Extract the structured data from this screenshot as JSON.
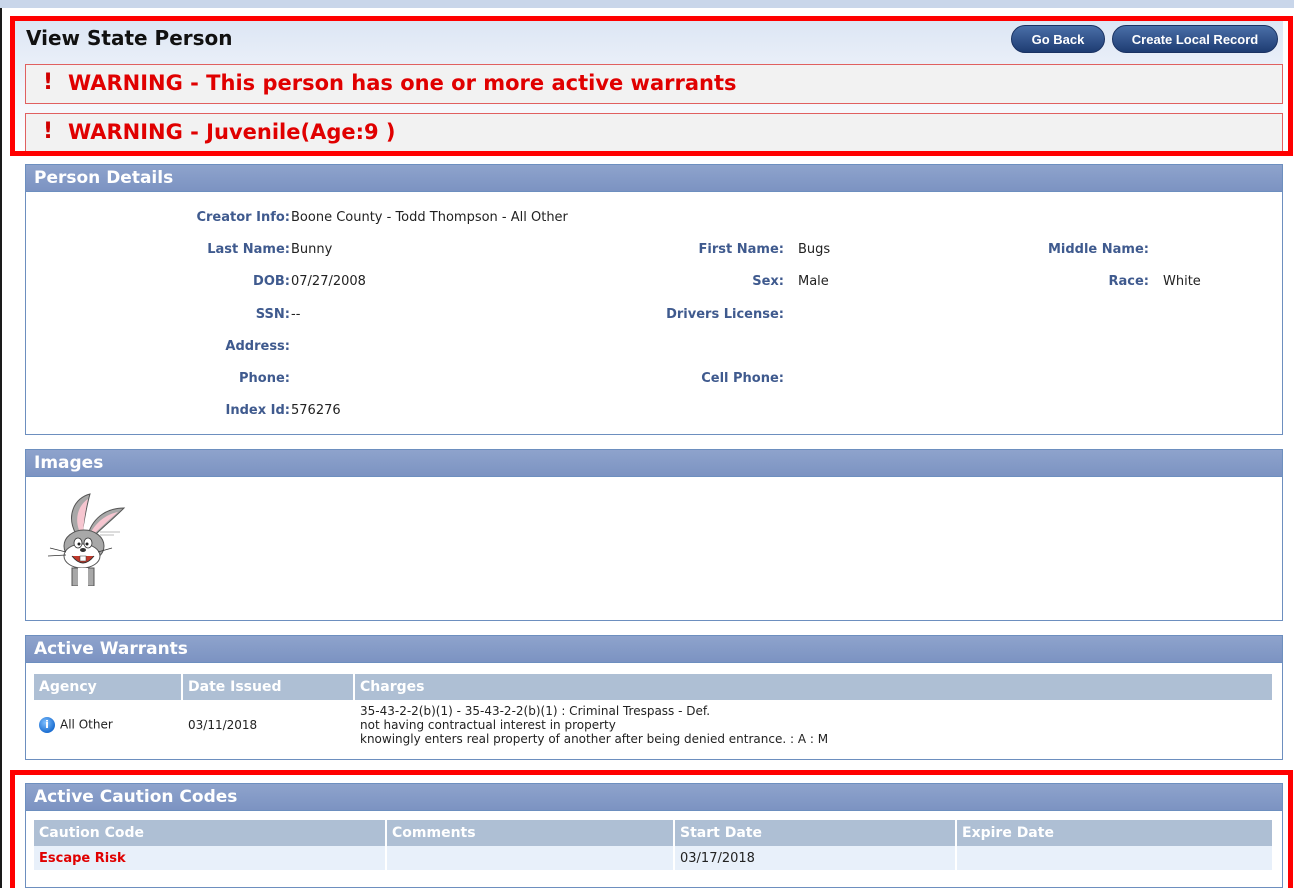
{
  "header": {
    "title": "View State Person",
    "buttons": {
      "go_back": "Go Back",
      "create_local": "Create Local Record"
    },
    "warnings": [
      "WARNING - This person has one or more active warrants",
      "WARNING - Juvenile(Age:9 )"
    ],
    "warning_icon": "!"
  },
  "person_details": {
    "heading": "Person Details",
    "creator_info": {
      "label": "Creator Info:",
      "value": "Boone County - Todd Thompson - All Other"
    },
    "last_name": {
      "label": "Last Name:",
      "value": "Bunny"
    },
    "first_name": {
      "label": "First Name:",
      "value": "Bugs"
    },
    "middle_name": {
      "label": "Middle Name:",
      "value": ""
    },
    "dob": {
      "label": "DOB:",
      "value": "07/27/2008"
    },
    "sex": {
      "label": "Sex:",
      "value": "Male"
    },
    "race": {
      "label": "Race:",
      "value": "White"
    },
    "ssn": {
      "label": "SSN:",
      "value": "--"
    },
    "drivers_license": {
      "label": "Drivers License:",
      "value": ""
    },
    "address": {
      "label": "Address:",
      "value": ""
    },
    "phone": {
      "label": "Phone:",
      "value": ""
    },
    "cell_phone": {
      "label": "Cell Phone:",
      "value": ""
    },
    "index_id": {
      "label": "Index Id:",
      "value": "576276"
    }
  },
  "images": {
    "heading": "Images"
  },
  "active_warrants": {
    "heading": "Active Warrants",
    "columns": [
      "Agency",
      "Date Issued",
      "Charges"
    ],
    "rows": [
      {
        "agency": "All Other",
        "date_issued": "03/11/2018",
        "charges": [
          "35-43-2-2(b)(1) - 35-43-2-2(b)(1) : Criminal Trespass - Def.",
          "not having contractual interest in property",
          "knowingly enters real property of another after being denied entrance. : A : M"
        ]
      }
    ]
  },
  "active_caution_codes": {
    "heading": "Active Caution Codes",
    "columns": [
      "Caution Code",
      "Comments",
      "Start Date",
      "Expire Date"
    ],
    "rows": [
      {
        "caution_code": "Escape Risk",
        "comments": "",
        "start_date": "03/17/2018",
        "expire_date": ""
      }
    ]
  },
  "colors": {
    "warning_red": "#e00000",
    "panel_header": "#8ea3cc",
    "label_blue": "#3f5a8e",
    "highlight_frame": "#ff0000"
  }
}
